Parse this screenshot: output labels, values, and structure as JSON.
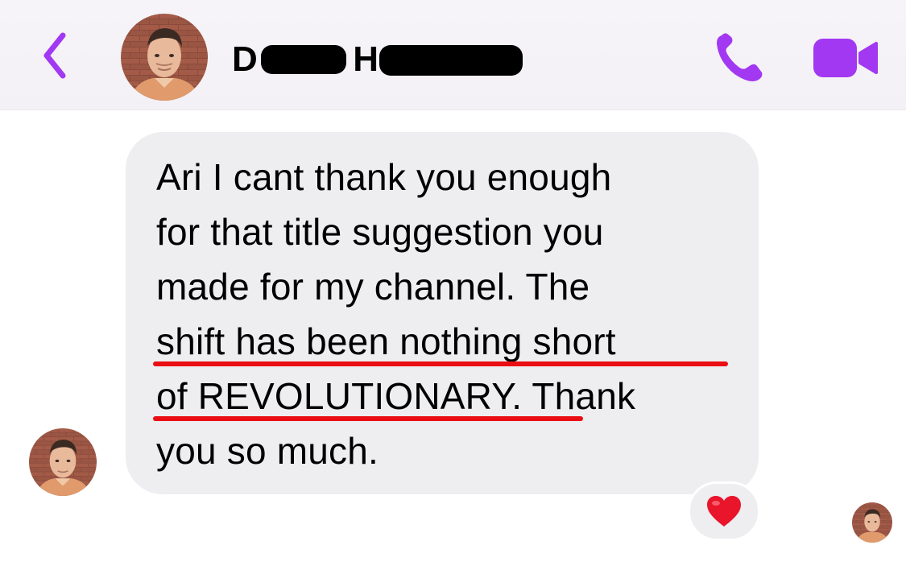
{
  "header": {
    "contact_name_first": "D",
    "contact_name_last": "H",
    "back_icon": "chevron-left-icon",
    "call_icon": "phone-icon",
    "video_icon": "video-camera-icon",
    "accent_color": "#a238f1"
  },
  "conversation": {
    "messages": [
      {
        "sender": "contact",
        "lines": [
          "Ari I cant thank you enough",
          "for that title suggestion you",
          "made for my channel. The",
          "shift has been nothing short",
          "of REVOLUTIONARY. Thank",
          "you so much."
        ],
        "highlighted_text": "shift has been nothing short of REVOLUTIONARY.",
        "highlight_color": "#ea0e14",
        "reaction": "❤️"
      }
    ]
  }
}
